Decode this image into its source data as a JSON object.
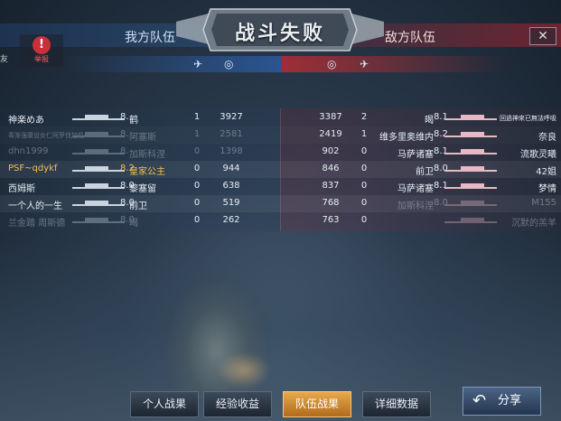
{
  "header": {
    "title": "战斗失败",
    "my_team": "我方队伍",
    "enemy_team": "敌方队伍",
    "close_glyph": "✕",
    "report_label": "举报",
    "friend_fragment": "友"
  },
  "rows": [
    {
      "left_name": "神楽めあ",
      "left_tier": "8.",
      "left_ship": "鹤",
      "left_kills": "1",
      "left_score": "3927",
      "right_score": "3387",
      "right_kills": "2",
      "right_ship": "暍",
      "right_tier": "8.1",
      "right_name": "回過神來已無法呼吸"
    },
    {
      "left_name": "毒渐强康设女仁阿罗伐加伦",
      "left_tier": "8.",
      "left_ship": "阿塞斯",
      "left_kills": "1",
      "left_score": "2581",
      "right_score": "2419",
      "right_kills": "1",
      "right_ship": "维多里奥维内",
      "right_tier": "8.2",
      "right_name": "奈良"
    },
    {
      "left_name": "dhn1999",
      "left_tier": "8.",
      "left_ship": "加斯科涅",
      "left_kills": "0",
      "left_score": "1398",
      "right_score": "902",
      "right_kills": "0",
      "right_ship": "马萨诸塞",
      "right_tier": "8.1",
      "right_name": "流歌灵曦"
    },
    {
      "left_name": "PSF~qdykf",
      "left_tier": "8.2",
      "left_ship": "皇家公主",
      "left_kills": "0",
      "left_score": "944",
      "right_score": "846",
      "right_kills": "0",
      "right_ship": "前卫",
      "right_tier": "8.0",
      "right_name": "42姐"
    },
    {
      "left_name": "西姆斯",
      "left_tier": "8.0",
      "left_ship": "黎塞留",
      "left_kills": "0",
      "left_score": "638",
      "right_score": "837",
      "right_kills": "0",
      "right_ship": "马萨诸塞",
      "right_tier": "8.1",
      "right_name": "梦情"
    },
    {
      "left_name": "一个人的一生",
      "left_tier": "8.0",
      "left_ship": "前卫",
      "left_kills": "0",
      "left_score": "519",
      "right_score": "768",
      "right_kills": "0",
      "right_ship": "加斯科涅",
      "right_tier": "8.0",
      "right_name": "M155"
    },
    {
      "left_name": "兰金踏 周斯德",
      "left_tier": "8.0",
      "left_ship": "暍",
      "left_kills": "0",
      "left_score": "262",
      "right_score": "763",
      "right_kills": "0",
      "right_ship": "",
      "right_tier": "",
      "right_name": "沉默的羔羊"
    }
  ],
  "tabs": {
    "personal": "个人战果",
    "experience": "经验收益",
    "team": "队伍战果",
    "details": "详细数据"
  },
  "share": {
    "label": "分享",
    "icon": "↶"
  },
  "icons": {
    "plane": "✈",
    "target": "◎"
  },
  "colors": {
    "self_highlight": "#f2c14e",
    "active_tab": "#e8a94a",
    "enemy": "#b02d3a",
    "ally": "#2d5fa8"
  }
}
